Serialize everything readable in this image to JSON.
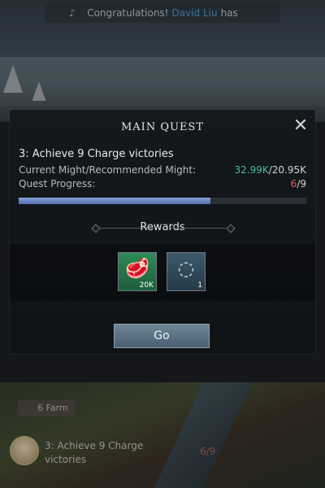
{
  "announcement": {
    "prefix": "Congratulations!",
    "name": "David Liu",
    "suffix": "has"
  },
  "quest_panel": {
    "title": "MAIN QUEST",
    "quest_name": "3: Achieve 9 Charge victories",
    "might_label": "Current Might/Recommended Might:",
    "might_current": "32.99K",
    "might_recommended": "20.95K",
    "progress_label": "Quest Progress:",
    "progress_current": "6",
    "progress_total": "9",
    "progress_fraction": 0.667,
    "rewards_title": "Rewards",
    "rewards": [
      {
        "icon": "meat-icon",
        "count": "20K"
      },
      {
        "icon": "beads-icon",
        "count": "1"
      }
    ],
    "go_label": "Go"
  },
  "map": {
    "farm_label": "6 Farm",
    "tracker_quest": "3: Achieve 9 Charge victories",
    "tracker_progress": "6/9"
  },
  "colors": {
    "might_value": "#3dbfa7",
    "progress_current": "#e05a5a",
    "progress_fill": "#6a88c4",
    "highlight_name": "#4a8fbf"
  }
}
